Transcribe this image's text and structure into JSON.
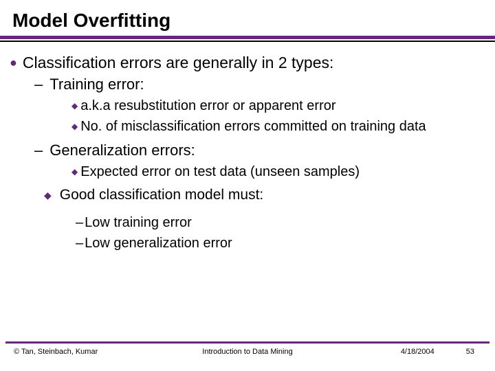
{
  "title": "Model Overfitting",
  "bullets": {
    "main": "Classification errors are generally in 2 types:",
    "sub1": "Training error:",
    "sub1a": "a.k.a resubstitution error or apparent error",
    "sub1b": "No. of misclassification errors committed on training data",
    "sub2": "Generalization errors:",
    "sub2a": "Expected error on test data (unseen samples)",
    "good": "Good classification model must:",
    "gooda": "Low training error",
    "goodb": "Low generalization error"
  },
  "footer": {
    "left": "© Tan, Steinbach, Kumar",
    "center": "Introduction to Data Mining",
    "date": "4/18/2004",
    "page": "53"
  }
}
